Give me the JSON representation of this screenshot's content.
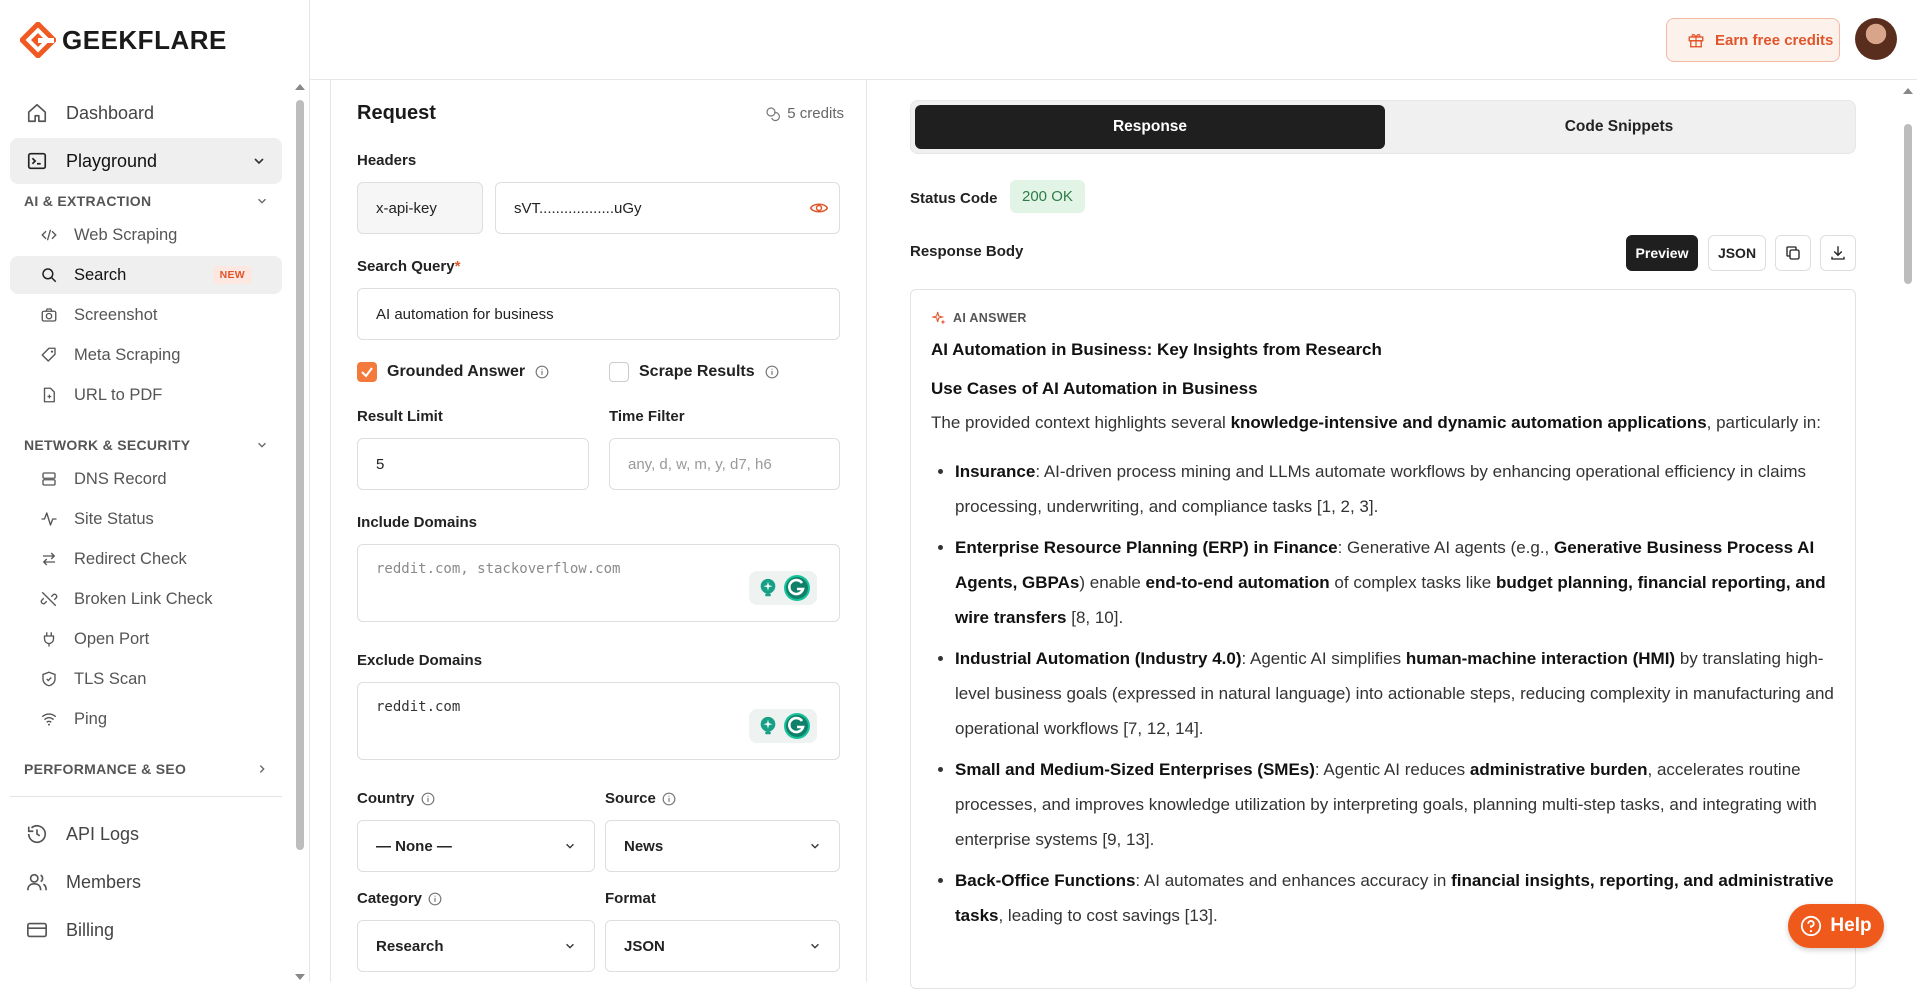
{
  "brand": {
    "name": "GEEKFLARE",
    "accent": "#f05a22"
  },
  "topbar": {
    "earn_label": "Earn free credits"
  },
  "sidebar": {
    "dashboard": "Dashboard",
    "playground": "Playground",
    "section_ai": "AI & EXTRACTION",
    "ai_items": [
      {
        "label": "Web Scraping",
        "icon": "code-icon"
      },
      {
        "label": "Search",
        "icon": "search-icon",
        "badge": "NEW"
      },
      {
        "label": "Screenshot",
        "icon": "camera-icon"
      },
      {
        "label": "Meta Scraping",
        "icon": "tag-icon"
      },
      {
        "label": "URL to PDF",
        "icon": "pdf-icon"
      }
    ],
    "section_net": "NETWORK & SECURITY",
    "net_items": [
      {
        "label": "DNS Record",
        "icon": "server-icon"
      },
      {
        "label": "Site Status",
        "icon": "activity-icon"
      },
      {
        "label": "Redirect Check",
        "icon": "redirect-icon"
      },
      {
        "label": "Broken Link Check",
        "icon": "broken-link-icon"
      },
      {
        "label": "Open Port",
        "icon": "plug-icon"
      },
      {
        "label": "TLS Scan",
        "icon": "shield-icon"
      },
      {
        "label": "Ping",
        "icon": "wifi-icon"
      }
    ],
    "section_perf": "PERFORMANCE & SEO",
    "bottom_items": [
      {
        "label": "API Logs",
        "icon": "history-icon"
      },
      {
        "label": "Members",
        "icon": "users-icon"
      },
      {
        "label": "Billing",
        "icon": "card-icon"
      }
    ]
  },
  "request": {
    "title": "Request",
    "credits": "5 credits",
    "headers_label": "Headers",
    "header_key": "x-api-key",
    "header_value": "sVT..................uGy",
    "query_label": "Search Query",
    "required_mark": "*",
    "query_value": "AI automation for business",
    "grounded_label": "Grounded Answer",
    "grounded_checked": true,
    "scrape_label": "Scrape Results",
    "scrape_checked": false,
    "limit_label": "Result Limit",
    "limit_value": "5",
    "time_label": "Time Filter",
    "time_placeholder": "any, d, w, m, y, d7, h6",
    "include_label": "Include Domains",
    "include_placeholder": "reddit.com, stackoverflow.com",
    "exclude_label": "Exclude Domains",
    "exclude_value": "reddit.com",
    "country_label": "Country",
    "country_value": "— None —",
    "source_label": "Source",
    "source_value": "News",
    "category_label": "Category",
    "category_value": "Research",
    "format_label": "Format",
    "format_value": "JSON"
  },
  "response": {
    "tab_response": "Response",
    "tab_code": "Code Snippets",
    "status_label": "Status Code",
    "status_value": "200 OK",
    "body_label": "Response Body",
    "btn_preview": "Preview",
    "btn_json": "JSON",
    "ai_tag": "AI ANSWER",
    "answer_title": "AI Automation in Business: Key Insights from Research",
    "use_cases_heading": "Use Cases of AI Automation in Business",
    "intro_pre": "The provided context highlights several ",
    "intro_bold": "knowledge-intensive and dynamic automation applications",
    "intro_post": ", particularly in:",
    "p1_b": "Insurance",
    "p1_t": ": AI-driven process mining and LLMs automate workflows by enhancing operational efficiency in claims processing, underwriting, and compliance tasks [1, 2, 3].",
    "p2_b": "Enterprise Resource Planning (ERP) in Finance",
    "p2_t1": ": Generative AI agents (e.g., ",
    "p2_b2": "Generative Business Process AI Agents, GBPAs",
    "p2_t2": ") enable ",
    "p2_b3": "end-to-end automation",
    "p2_t3": " of complex tasks like ",
    "p2_b4": "budget planning, financial reporting, and wire transfers",
    "p2_t4": " [8, 10].",
    "p3_b": "Industrial Automation (Industry 4.0)",
    "p3_t1": ": Agentic AI simplifies ",
    "p3_b2": "human-machine interaction (HMI)",
    "p3_t2": " by translating high-level business goals (expressed in natural language) into actionable steps, reducing complexity in manufacturing and operational workflows [7, 12, 14].",
    "p4_b": "Small and Medium-Sized Enterprises (SMEs)",
    "p4_t1": ": Agentic AI reduces ",
    "p4_b2": "administrative burden",
    "p4_t2": ", accelerates routine processes, and improves knowledge utilization by interpreting goals, planning multi-step tasks, and integrating with enterprise systems [9, 13].",
    "p5_b": "Back-Office Functions",
    "p5_t1": ": AI automates and enhances accuracy in ",
    "p5_b2": "financial insights, reporting, and administrative tasks",
    "p5_t2": ", leading to cost savings [13]."
  },
  "help": {
    "label": "Help"
  }
}
